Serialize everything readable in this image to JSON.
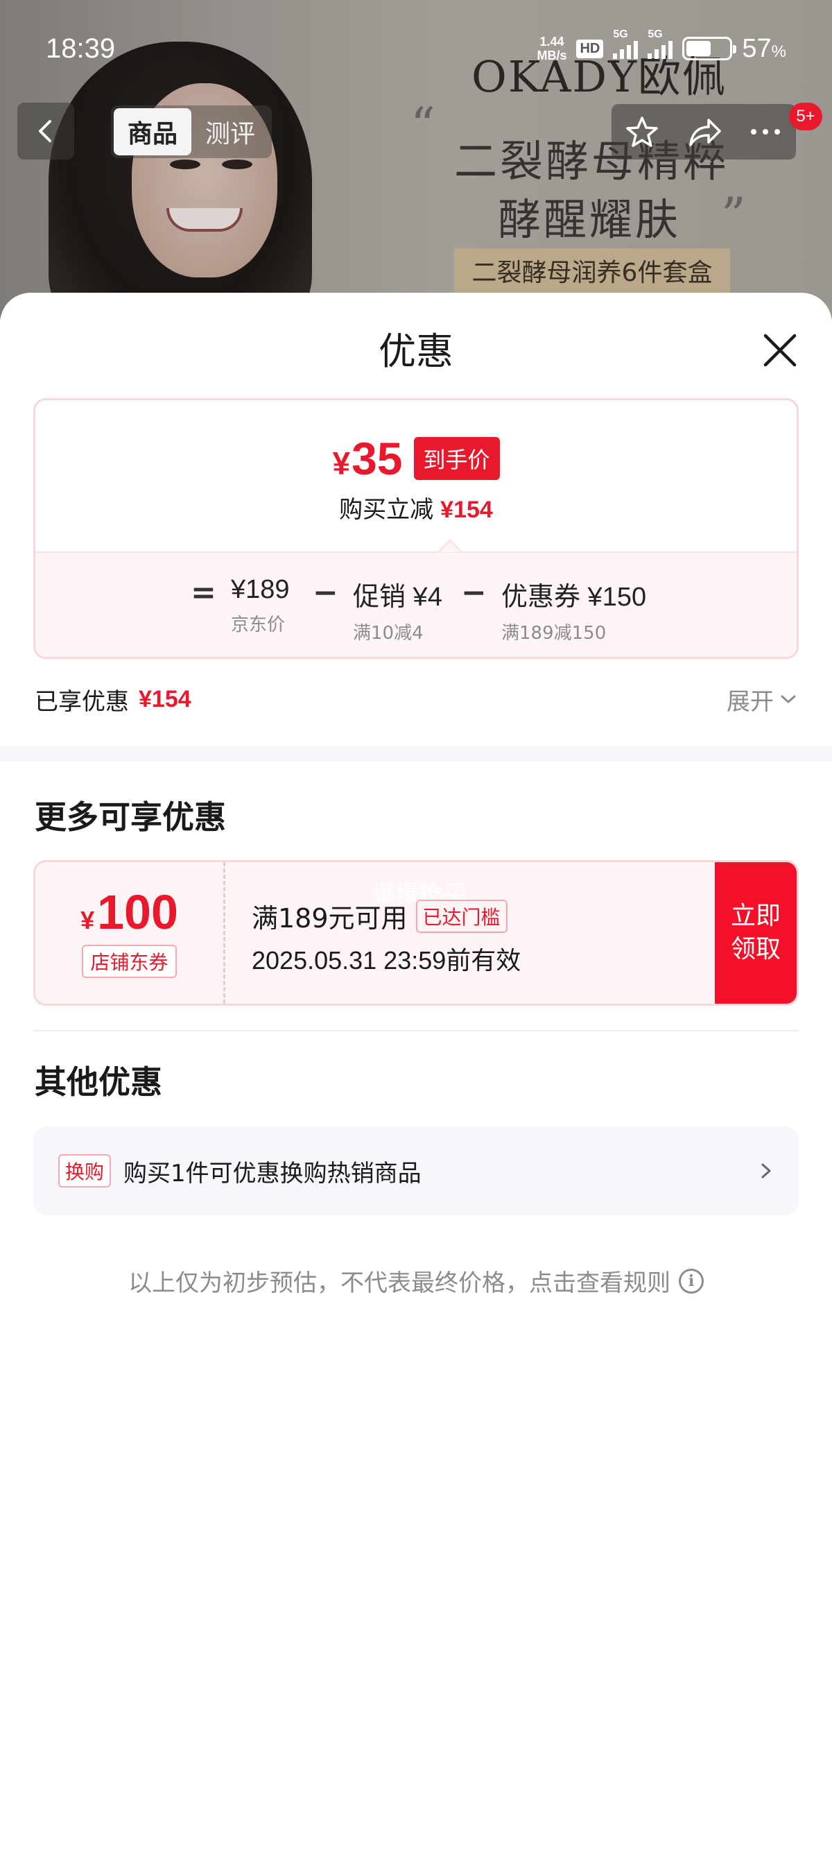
{
  "status_bar": {
    "time": "18:39",
    "net_speed_value": "1.44",
    "net_speed_unit": "MB/s",
    "hd_label": "HD",
    "sim1_label": "5G",
    "sim2_label": "5G",
    "battery_value": "57",
    "battery_unit": "%",
    "battery_level": 0.57
  },
  "background_page": {
    "brand_logo": "OKADY欧佩",
    "slogan_line1": "二裂酵母精粹",
    "slogan_line2": "酵醒耀肤",
    "product_tag": "二裂酵母润养6件套盒",
    "quote_open": "“",
    "quote_close": "”",
    "nav": {
      "tabs": [
        "商品",
        "测评"
      ],
      "active_tab": 0,
      "cart_badge": "5+",
      "icons": [
        "back-arrow-icon",
        "star-icon",
        "share-icon",
        "more-icon"
      ]
    }
  },
  "sheet": {
    "title": "优惠",
    "close_icon": "close-icon",
    "price_summary": {
      "currency": "¥",
      "final_price": "35",
      "final_tag": "到手价",
      "reduce_label": "购买立减",
      "reduce_amount": "¥154",
      "formula": {
        "equals": "=",
        "minus": "−",
        "jd_price": "¥189",
        "jd_price_label": "京东价",
        "promo_label": "促销 ¥4",
        "promo_sub": "满10减4",
        "coupon_label": "优惠券 ¥150",
        "coupon_sub": "满189减150"
      }
    },
    "enjoyed": {
      "label": "已享优惠",
      "amount": "¥154",
      "expand_label": "展开",
      "expand_icon": "chevron-down-icon"
    },
    "more_section_title": "更多可享优惠",
    "coupon": {
      "currency": "¥",
      "amount": "100",
      "type_label": "店铺东券",
      "condition": "满189元可用",
      "status_tag": "已达门槛",
      "expire": "2025.05.31 23:59前有效",
      "watermark": "爆爆抢买",
      "claim_button": "立即领取"
    },
    "other_section_title": "其他优惠",
    "other_offer": {
      "tag": "换购",
      "text": "购买1件可优惠换购热销商品",
      "icon": "chevron-right-icon"
    },
    "disclaimer": "以上仅为初步预估，不代表最终价格，点击查看规则",
    "disclaimer_icon": "info-icon",
    "colors": {
      "accent_red": "#e8192c",
      "button_red": "#f5102a",
      "card_border": "#f8d7db",
      "muted_text": "#8c8c8c",
      "panel_bg": "#f6f7fb"
    }
  }
}
